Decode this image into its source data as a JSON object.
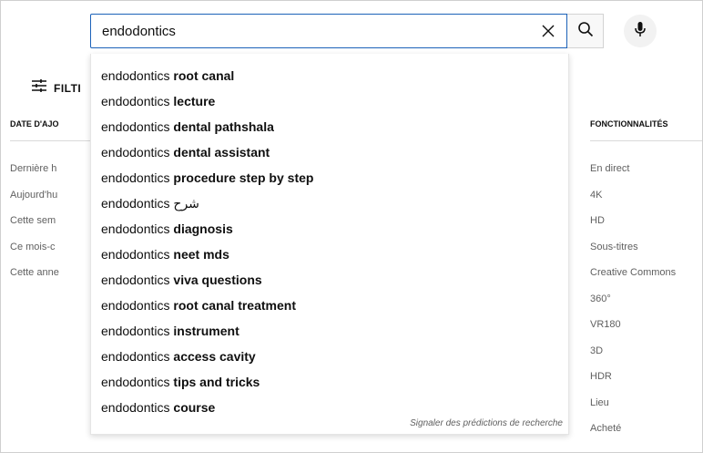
{
  "search": {
    "query": "endodontics",
    "suggestions": [
      {
        "prefix": "endodontics ",
        "completion": "root canal"
      },
      {
        "prefix": "endodontics ",
        "completion": "lecture"
      },
      {
        "prefix": "endodontics ",
        "completion": "dental pathshala"
      },
      {
        "prefix": "endodontics ",
        "completion": "dental assistant"
      },
      {
        "prefix": "endodontics ",
        "completion": "procedure step by step"
      },
      {
        "prefix": "endodontics ",
        "completion": "شرح"
      },
      {
        "prefix": "endodontics ",
        "completion": "diagnosis"
      },
      {
        "prefix": "endodontics ",
        "completion": "neet mds"
      },
      {
        "prefix": "endodontics ",
        "completion": "viva questions"
      },
      {
        "prefix": "endodontics ",
        "completion": "root canal treatment"
      },
      {
        "prefix": "endodontics ",
        "completion": "instrument"
      },
      {
        "prefix": "endodontics ",
        "completion": "access cavity"
      },
      {
        "prefix": "endodontics ",
        "completion": "tips and tricks"
      },
      {
        "prefix": "endodontics ",
        "completion": "course"
      }
    ],
    "report_link": "Signaler des prédictions de recherche"
  },
  "icons": {
    "clear": "close-icon",
    "search": "search-icon",
    "mic": "microphone-icon",
    "filters": "tune-icon"
  },
  "filters": {
    "label": "FILTI",
    "upload_date": {
      "title": "DATE D'AJO",
      "items": [
        "Dernière h",
        "Aujourd'hu",
        "Cette sem",
        "Ce mois-c",
        "Cette anne"
      ]
    },
    "features": {
      "title": "FONCTIONNALITÉS",
      "items": [
        "En direct",
        "4K",
        "HD",
        "Sous-titres",
        "Creative Commons",
        "360°",
        "VR180",
        "3D",
        "HDR",
        "Lieu",
        "Acheté"
      ]
    }
  },
  "colors": {
    "focus_border": "#1c62b9",
    "secondary_text": "#606060"
  }
}
